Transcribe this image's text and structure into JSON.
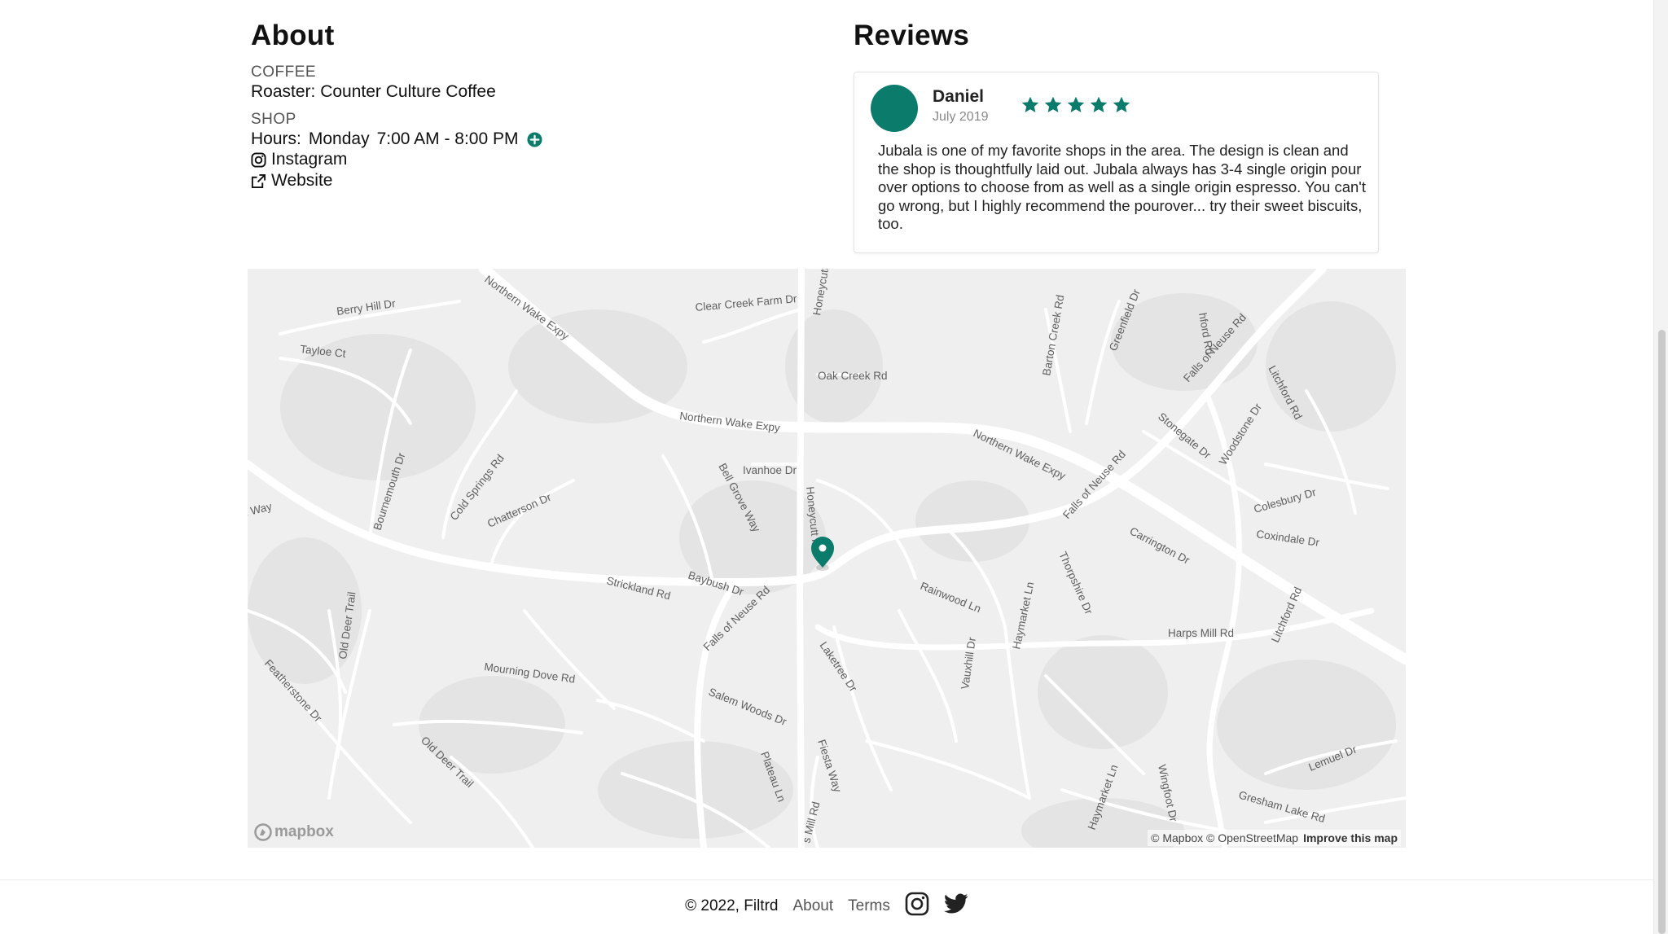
{
  "colors": {
    "accent": "#0b7b6b",
    "map_bg": "#efefef",
    "road": "#ffffff"
  },
  "about": {
    "title": "About",
    "coffee_label": "COFFEE",
    "roaster": "Roaster: Counter Culture Coffee",
    "shop_label": "SHOP",
    "hours_label": "Hours:",
    "hours_day": "Monday",
    "hours_time": "7:00 AM - 8:00 PM",
    "expand_icon": "plus-circle-icon",
    "instagram": "Instagram",
    "website": "Website"
  },
  "reviews": {
    "title": "Reviews",
    "items": [
      {
        "name": "Daniel",
        "date": "July 2019",
        "rating": 5,
        "text": "Jubala is one of my favorite shops in the area. The design is clean and the shop is thoughtfully laid out. Jubala always has 3-4 single origin pour over options to choose from as well as a single origin espresso. You can't go wrong, but I highly recommend the pourover... try their sweet biscuits, too."
      }
    ]
  },
  "map": {
    "labels": {
      "berry_hill": "Berry Hill Dr",
      "tayloe": "Tayloe Ct",
      "northern_wake_nw": "Northern Wake Expy",
      "clear_creek": "Clear Creek Farm Dr",
      "honeycutt_top": "Honeycutt Rd",
      "oak_creek": "Oak Creek Rd",
      "barton_creek": "Barton Creek Rd",
      "greenfield": "Greenfield Dr",
      "falls_neuse_ne": "Falls of Neuse Rd",
      "litchford_ne": "Litchford Rd",
      "northern_wake_mid": "Northern Wake Expy",
      "northern_wake_e": "Northern Wake Expy",
      "stonegate": "Stonegate Dr",
      "woodstone": "Woodstone Dr",
      "ivanhoe": "Ivanhoe Dr",
      "bell_grove": "Bell Grove Way",
      "honeycutt_mid": "Honeycutt Rd",
      "bournemouth": "Bournemouth Dr",
      "cold_springs": "Cold Springs Rd",
      "chatterson": "Chatterson Dr",
      "falls_neuse_e": "Falls of Neuse Rd",
      "colesbury": "Colesbury Dr",
      "coxindale": "Coxindale Dr",
      "carrington": "Carrington Dr",
      "strickland": "Strickland Rd",
      "baybush": "Baybush Dr",
      "falls_neuse_sw": "Falls of Neuse Rd",
      "rainwood": "Rainwood Ln",
      "thorpshire": "Thorpshire Dr",
      "haymarket_mid": "Haymarket Ln",
      "old_deer_left": "Old Deer Trail",
      "featherstone": "Featherstone Dr",
      "mourning_dove": "Mourning Dove Rd",
      "laketree": "Laketree Dr",
      "vauxhill": "Vauxhill Dr",
      "harps_mill": "Harps Mill Rd",
      "litchford_se": "Litchford Rd",
      "salem_woods": "Salem Woods Dr",
      "old_deer_bottom": "Old Deer Trail",
      "plateau": "Plateau Ln",
      "fiesta": "Fiesta Way",
      "mill_rd": "s Mill Rd",
      "haymarket_bottom": "Haymarket Ln",
      "wingfoot": "Wingfoot Dr",
      "lemuel": "Lemuel Dr",
      "gresham": "Gresham Lake Rd",
      "way_left": "n Way",
      "hford_top": "hford Rd"
    },
    "logo_text": "mapbox",
    "attribution": "© Mapbox © OpenStreetMap",
    "improve": "Improve this map",
    "marker_icon": "map-pin-icon"
  },
  "footer": {
    "copyright": "© 2022, Filtrd",
    "about": "About",
    "terms": "Terms",
    "instagram_icon": "instagram-icon",
    "twitter_icon": "twitter-icon"
  }
}
